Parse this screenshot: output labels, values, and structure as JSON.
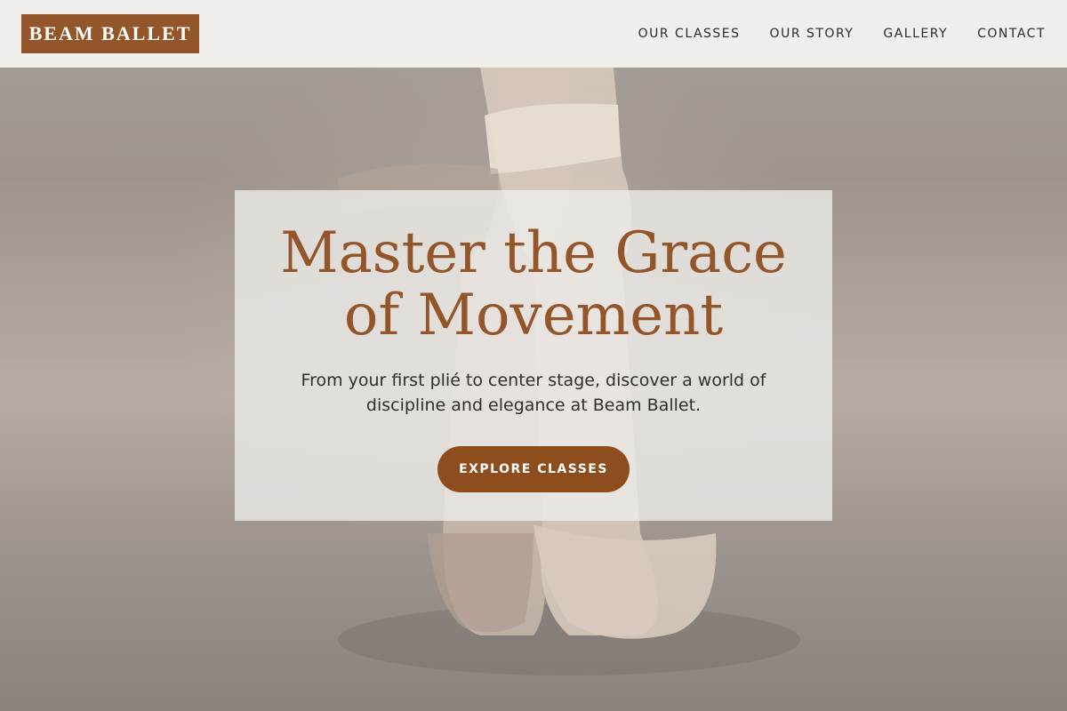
{
  "brand": {
    "logo_text": "BEAM BALLET",
    "accent_color": "#93552a"
  },
  "nav": {
    "items": [
      {
        "label": "OUR CLASSES"
      },
      {
        "label": "OUR STORY"
      },
      {
        "label": "GALLERY"
      },
      {
        "label": "CONTACT"
      }
    ]
  },
  "hero": {
    "headline_line1": "Master the Grace",
    "headline_line2": "of Movement",
    "subtext": "From your first plié to center stage, discover a world of discipline and elegance at Beam Ballet.",
    "cta_label": "EXPLORE CLASSES",
    "cta_color": "#8d4d1c",
    "background_image": "pointe-shoes-photo"
  }
}
